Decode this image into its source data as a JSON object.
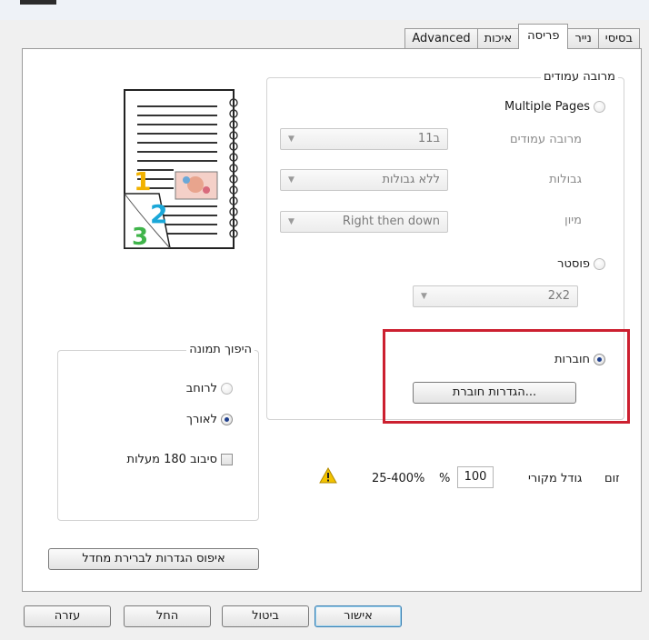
{
  "tabs": [
    {
      "label": "בסיסי",
      "active": false
    },
    {
      "label": "נייר",
      "active": false
    },
    {
      "label": "פריסה",
      "active": true
    },
    {
      "label": "איכות",
      "active": false
    },
    {
      "label": "Advanced",
      "active": false
    }
  ],
  "preview": {
    "numbers": [
      "1",
      "2",
      "3"
    ]
  },
  "multi_page_group": {
    "title": "מרובה עמודים",
    "multiple_pages_radio": "Multiple Pages",
    "pages_per_sheet_label": "מרובה עמודים",
    "pages_per_sheet_value": "1ב1",
    "borders_label": "גבולות",
    "borders_value": "ללא גבולות",
    "order_label": "מיון",
    "order_value": "Right then down",
    "poster_radio": "פוסטר",
    "poster_value": "2x2",
    "booklet_radio": "חוברות",
    "booklet_settings_button": "הגדרות חוברת..."
  },
  "orientation_group": {
    "title": "היפוך תמונה",
    "landscape": "לרוחב",
    "portrait": "לאורך",
    "rotate180": "סיבוב 180 מעלות"
  },
  "zoom": {
    "label": "זום",
    "original_size": "גודל מקורי",
    "value": "100",
    "unit": "%",
    "range": "25-400%"
  },
  "reset_button": "איפוס הגדרות לברירת מחדל",
  "footer": {
    "ok": "אישור",
    "cancel": "ביטול",
    "apply": "החל",
    "help": "עזרה"
  },
  "colors": {
    "highlight": "#cc2030",
    "accent": "#1f3f8c",
    "warning": "#f2c200"
  }
}
